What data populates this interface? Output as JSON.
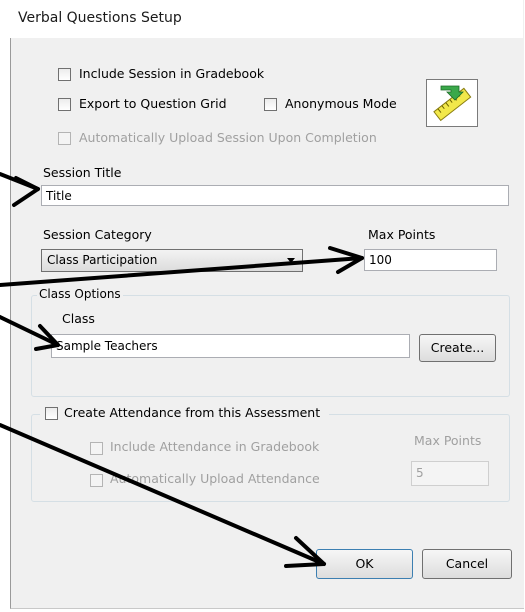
{
  "window": {
    "title": "Verbal Questions Setup"
  },
  "options": {
    "include_session_gradebook": {
      "label": "Include Session in Gradebook",
      "enabled": true,
      "checked": false
    },
    "export_question_grid": {
      "label": "Export to Question Grid",
      "enabled": true,
      "checked": false
    },
    "anonymous_mode": {
      "label": "Anonymous Mode",
      "enabled": true,
      "checked": false
    },
    "auto_upload_session": {
      "label": "Automatically Upload Session Upon Completion",
      "enabled": false,
      "checked": false
    }
  },
  "ruler_icon": "ruler-pencil-icon",
  "session_title": {
    "label": "Session Title",
    "value": "Title"
  },
  "session_category": {
    "label": "Session Category",
    "value": "Class Participation"
  },
  "max_points": {
    "label": "Max Points",
    "value": "100"
  },
  "class_options": {
    "legend": "Class Options",
    "class_label": "Class",
    "class_value": "Sample Teachers",
    "create_button": "Create..."
  },
  "attendance": {
    "label": "Create Attendance from this Assessment",
    "include_gradebook_label": "Include Attendance in Gradebook",
    "auto_upload_label": "Automatically Upload Attendance",
    "max_points_label": "Max Points",
    "max_points_value": "5"
  },
  "buttons": {
    "ok": "OK",
    "cancel": "Cancel"
  },
  "colors": {
    "dialog_bg": "#f0f0f0",
    "ruler_yellow": "#f2e84a",
    "arrow": "#000000"
  }
}
